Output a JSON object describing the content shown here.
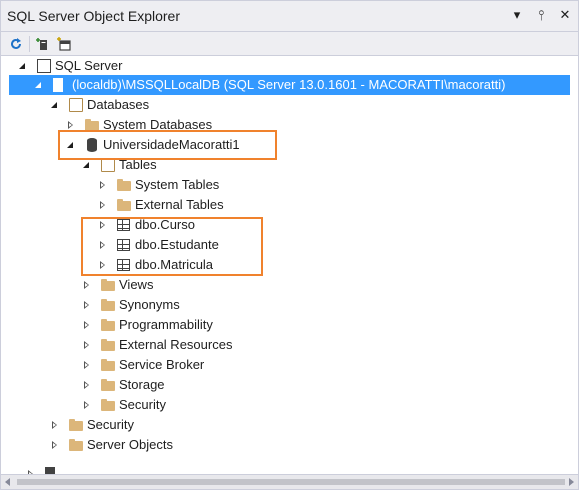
{
  "window": {
    "title": "SQL Server Object Explorer",
    "icons": {
      "dropdown": "▾",
      "pin": "ᵩ",
      "close": "✕"
    }
  },
  "toolbar": {
    "refresh_icon": "refresh-icon",
    "add_sql_server_icon": "add-server-icon",
    "new_query_icon": "new-query-icon"
  },
  "tree": {
    "root": "SQL Server",
    "server": "(localdb)\\MSSQLLocalDB (SQL Server 13.0.1601 - MACORATTI\\macoratti)",
    "databases": "Databases",
    "system_databases": "System Databases",
    "database": "UniversidadeMacoratti1",
    "tables": "Tables",
    "system_tables": "System Tables",
    "external_tables": "External Tables",
    "table_items": [
      "dbo.Curso",
      "dbo.Estudante",
      "dbo.Matricula"
    ],
    "views": "Views",
    "synonyms": "Synonyms",
    "programmability": "Programmability",
    "external_resources": "External Resources",
    "service_broker": "Service Broker",
    "storage": "Storage",
    "db_security": "Security",
    "security": "Security",
    "server_objects": "Server Objects"
  },
  "colors": {
    "selection": "#3399ff",
    "highlight_box": "#f0822d",
    "folder": "#dcb67a"
  }
}
